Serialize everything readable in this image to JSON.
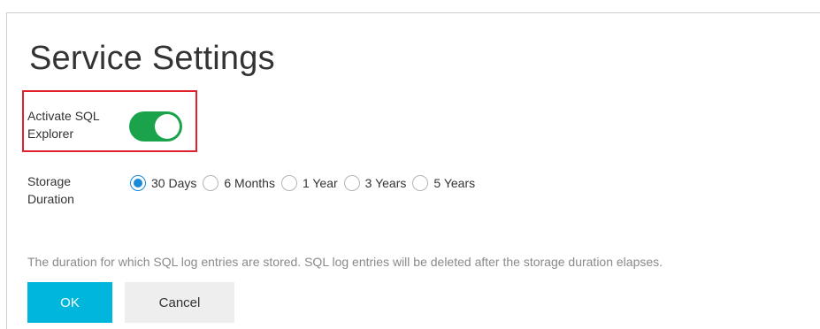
{
  "dialog": {
    "title": "Service Settings"
  },
  "sql_explorer": {
    "label_line1": "Activate SQL",
    "label_line2": "Explorer",
    "enabled": true,
    "accent_color": "#1aa34a",
    "highlight_color": "#e0202a"
  },
  "storage": {
    "label_line1": "Storage",
    "label_line2": "Duration",
    "options": [
      {
        "label": "30 Days",
        "checked": true
      },
      {
        "label": "6 Months",
        "checked": false
      },
      {
        "label": "1 Year",
        "checked": false
      },
      {
        "label": "3 Years",
        "checked": false
      },
      {
        "label": "5 Years",
        "checked": false
      }
    ],
    "selected_color": "#1a8ad8"
  },
  "help_text": "The duration for which SQL log entries are stored. SQL log entries will be deleted after the storage duration elapses.",
  "buttons": {
    "ok_label": "OK",
    "cancel_label": "Cancel",
    "ok_color": "#00b6dc"
  }
}
